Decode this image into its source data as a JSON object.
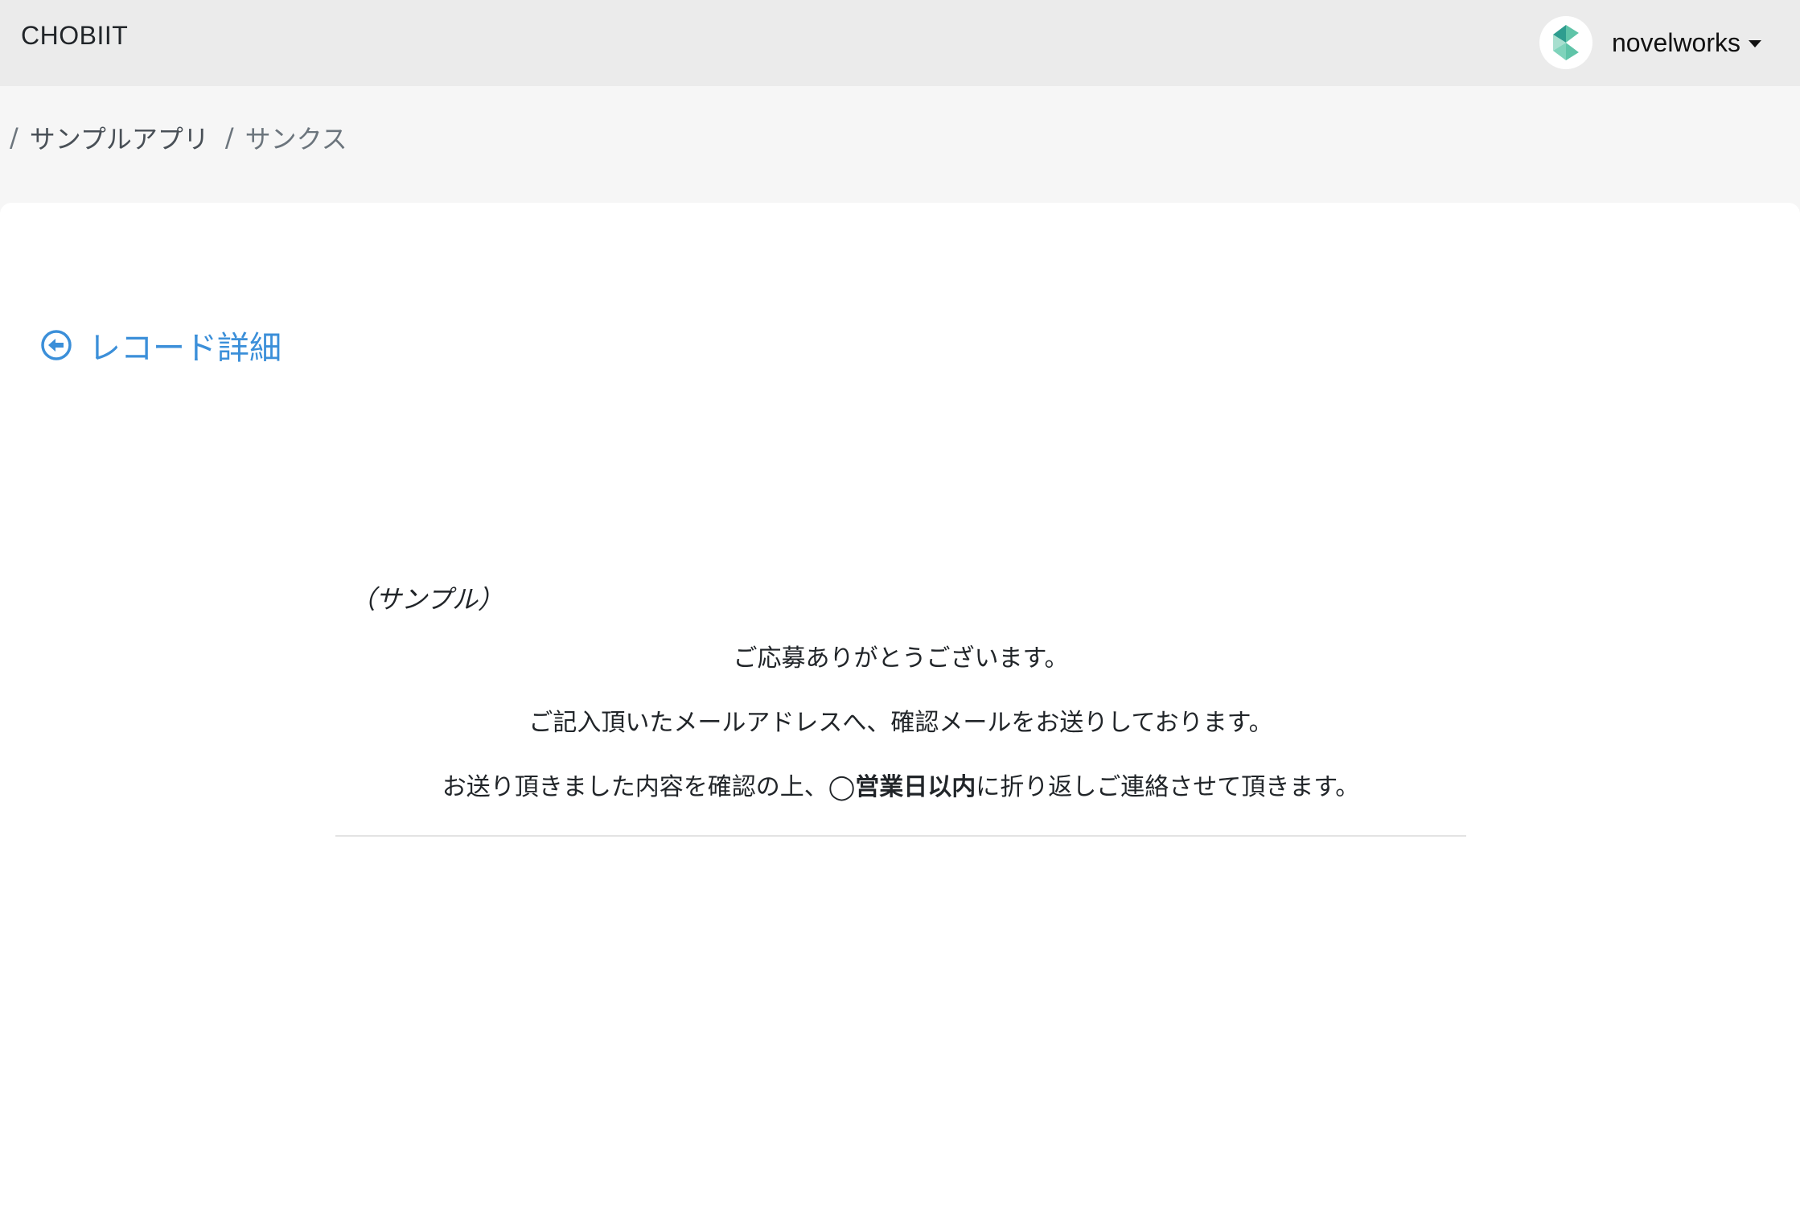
{
  "header": {
    "brand": "CHOBIIT",
    "user": {
      "name": "novelworks",
      "avatar_icon": "novelworks-logo-icon"
    }
  },
  "breadcrumb": {
    "separator": "/",
    "items": [
      {
        "label": "サンプルアプリ"
      },
      {
        "label": "サンクス"
      }
    ]
  },
  "back_link": {
    "label": "レコード詳細",
    "icon": "arrow-left-circle-icon",
    "color": "#3b8fd9"
  },
  "thanks": {
    "sample_label": "（サンプル）",
    "line1": "ご応募ありがとうございます。",
    "line2": "ご記入頂いたメールアドレスへ、確認メールをお送りしております。",
    "line3_pre": "お送り頂きました内容を確認の上、",
    "line3_bold": "◯営業日以内",
    "line3_post": "に折り返しご連絡させて頂きます。"
  },
  "colors": {
    "topbar": "#ebebeb",
    "page_bg": "#f6f6f6",
    "link": "#3b8fd9"
  }
}
